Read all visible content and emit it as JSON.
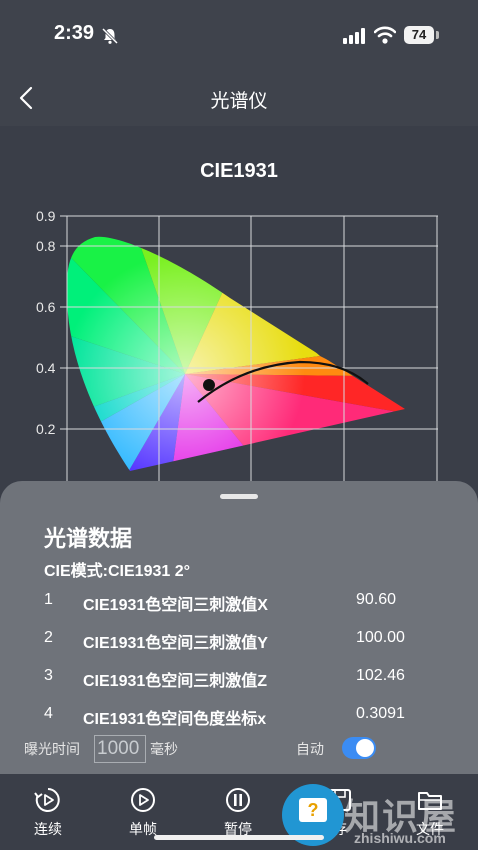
{
  "status": {
    "time": "2:39",
    "battery": "74"
  },
  "nav": {
    "title": "光谱仪"
  },
  "chart_data": {
    "type": "scatter",
    "title": "CIE1931",
    "yticks": [
      "0.9",
      "0.8",
      "0.6",
      "0.4",
      "0.2"
    ],
    "ylim": [
      0,
      0.9
    ],
    "grid": true,
    "point": {
      "x": 0.3091,
      "y": 0.33
    }
  },
  "panel": {
    "title": "光谱数据",
    "cie_mode": "CIE模式:CIE1931 2°",
    "rows": [
      {
        "idx": "1",
        "name": "CIE1931色空间三刺激值X",
        "value": "90.60"
      },
      {
        "idx": "2",
        "name": "CIE1931色空间三刺激值Y",
        "value": "100.00"
      },
      {
        "idx": "3",
        "name": "CIE1931色空间三刺激值Z",
        "value": "102.46"
      },
      {
        "idx": "4",
        "name": "CIE1931色空间色度坐标x",
        "value": "0.3091"
      }
    ],
    "exposure_label": "曝光时间",
    "exposure_value": "1000",
    "exposure_unit": "毫秒",
    "auto_label": "自动",
    "auto_on": true
  },
  "toolbar": {
    "continuous": "连续",
    "single": "单帧",
    "pause": "暂停",
    "save": "存",
    "file": "文件"
  },
  "watermark": {
    "text": "知识屋",
    "url": "zhishiwu.com"
  },
  "colors": {
    "accent": "#3b8cf3",
    "panel": "#6f737a",
    "background": "#3a3e48"
  }
}
